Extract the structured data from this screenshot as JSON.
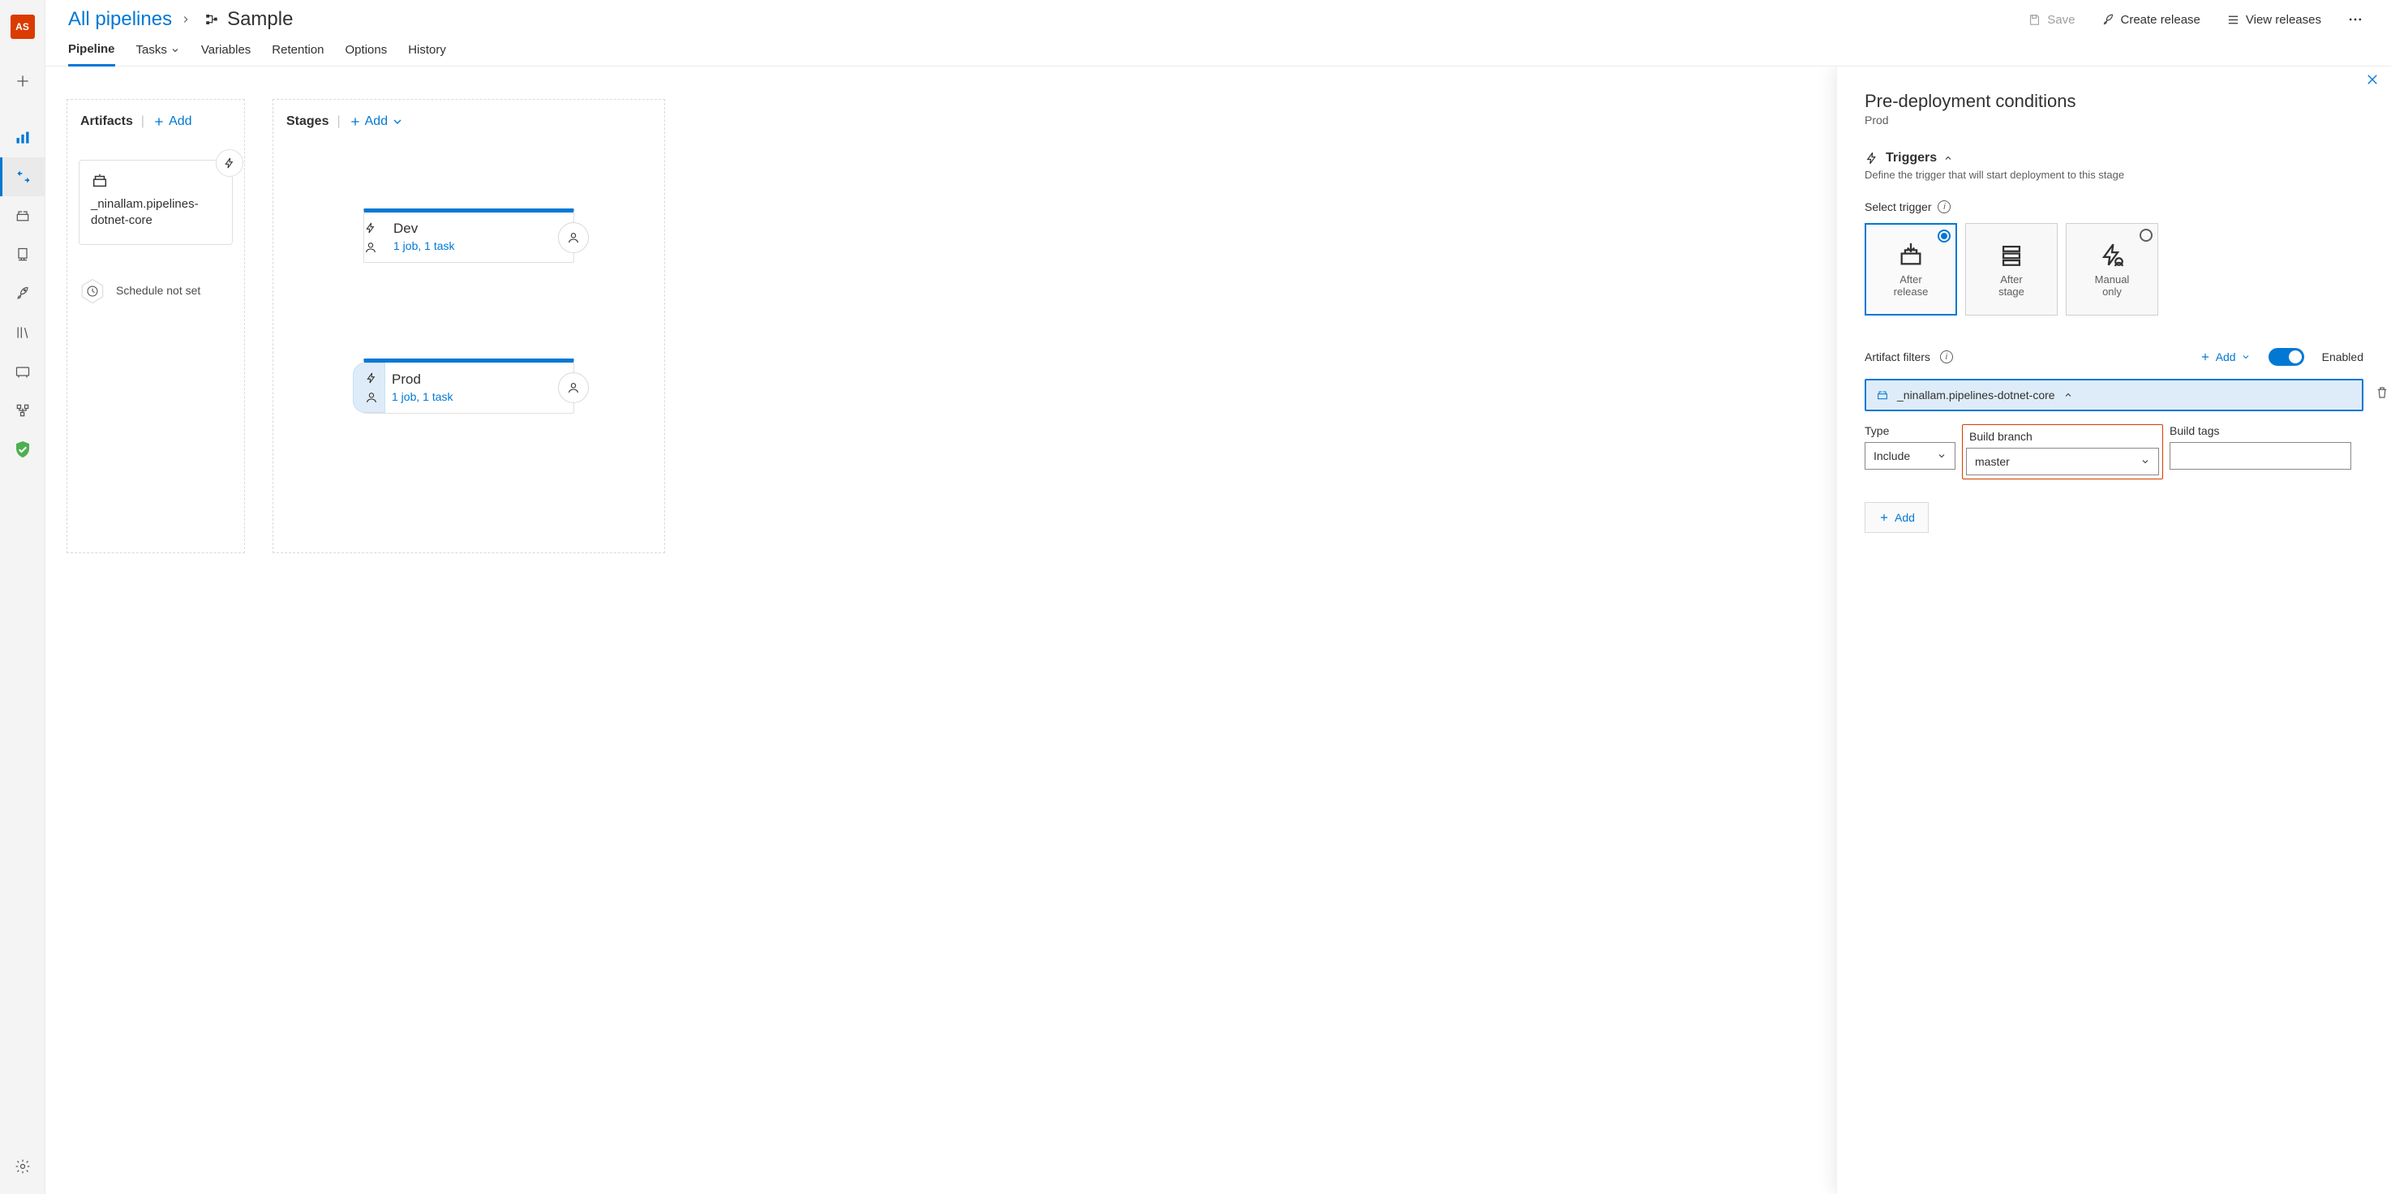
{
  "avatar": "AS",
  "breadcrumb": {
    "root": "All pipelines",
    "title": "Sample"
  },
  "topActions": {
    "save": "Save",
    "create": "Create release",
    "view": "View releases"
  },
  "tabs": [
    "Pipeline",
    "Tasks",
    "Variables",
    "Retention",
    "Options",
    "History"
  ],
  "activeTab": "Pipeline",
  "artifacts": {
    "heading": "Artifacts",
    "add": "Add",
    "card": {
      "name": "_ninallam.pipelines-dotnet-core"
    },
    "schedule": "Schedule not set"
  },
  "stages": {
    "heading": "Stages",
    "add": "Add",
    "items": [
      {
        "name": "Dev",
        "summary": "1 job, 1 task",
        "selected": false
      },
      {
        "name": "Prod",
        "summary": "1 job, 1 task",
        "selected": true
      }
    ]
  },
  "panel": {
    "title": "Pre-deployment conditions",
    "stage": "Prod",
    "triggers": {
      "heading": "Triggers",
      "desc": "Define the trigger that will start deployment to this stage",
      "selectLabel": "Select trigger",
      "options": [
        {
          "key": "release",
          "line1": "After",
          "line2": "release",
          "selected": true
        },
        {
          "key": "stage",
          "line1": "After",
          "line2": "stage",
          "selected": false
        },
        {
          "key": "manual",
          "line1": "Manual",
          "line2": "only",
          "selected": false
        }
      ]
    },
    "artifactFilters": {
      "heading": "Artifact filters",
      "add": "Add",
      "enabledLabel": "Enabled",
      "filter": {
        "name": "_ninallam.pipelines-dotnet-core",
        "typeLabel": "Type",
        "typeValue": "Include",
        "branchLabel": "Build branch",
        "branchValue": "master",
        "tagsLabel": "Build tags",
        "tagsValue": ""
      },
      "addRow": "Add"
    }
  }
}
